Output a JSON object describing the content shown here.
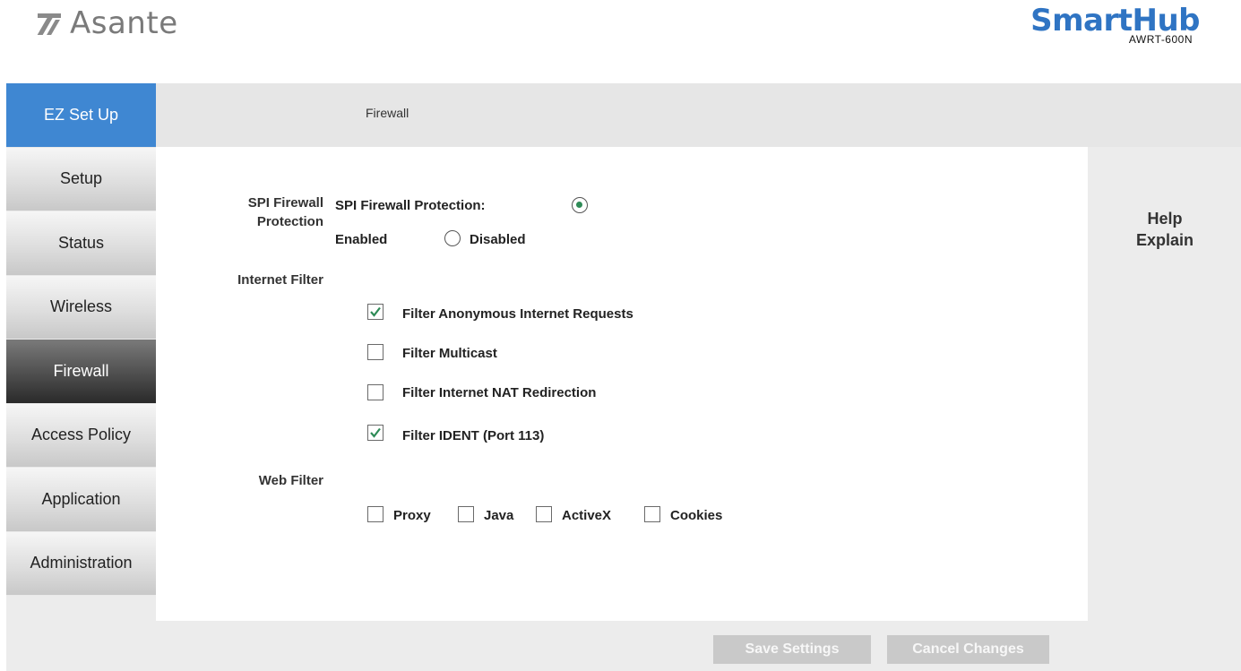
{
  "header": {
    "logo_text": "Asante",
    "brand_title": "SmartHub",
    "brand_model": "AWRT-600N"
  },
  "sidebar": {
    "items": [
      {
        "label": "EZ Set Up",
        "state": "highlight"
      },
      {
        "label": "Setup"
      },
      {
        "label": "Status"
      },
      {
        "label": "Wireless"
      },
      {
        "label": "Firewall",
        "state": "active"
      },
      {
        "label": "Access Policy"
      },
      {
        "label": "Application"
      },
      {
        "label": "Administration"
      }
    ]
  },
  "page": {
    "title": "Firewall"
  },
  "spi": {
    "section_label": "SPI Firewall Protection",
    "field_label": "SPI Firewall Protection:",
    "enabled_label": "Enabled",
    "disabled_label": "Disabled",
    "selected": "Enabled"
  },
  "internet_filter": {
    "section_label": "Internet Filter",
    "options": [
      {
        "label": "Filter Anonymous Internet Requests",
        "checked": true
      },
      {
        "label": "Filter Multicast",
        "checked": false
      },
      {
        "label": "Filter Internet NAT Redirection",
        "checked": false
      },
      {
        "label": "Filter IDENT (Port 113)",
        "checked": true
      }
    ]
  },
  "web_filter": {
    "section_label": "Web Filter",
    "options": [
      {
        "label": "Proxy",
        "checked": false
      },
      {
        "label": "Java",
        "checked": false
      },
      {
        "label": "ActiveX",
        "checked": false
      },
      {
        "label": "Cookies",
        "checked": false
      }
    ]
  },
  "help": {
    "line1": "Help",
    "line2": "Explain"
  },
  "buttons": {
    "save_label": "Save Settings",
    "cancel_label": "Cancel Changes"
  },
  "colors": {
    "brand_blue": "#2f74c3",
    "nav_highlight": "#3f87d2",
    "check_green": "#2e8b57"
  }
}
